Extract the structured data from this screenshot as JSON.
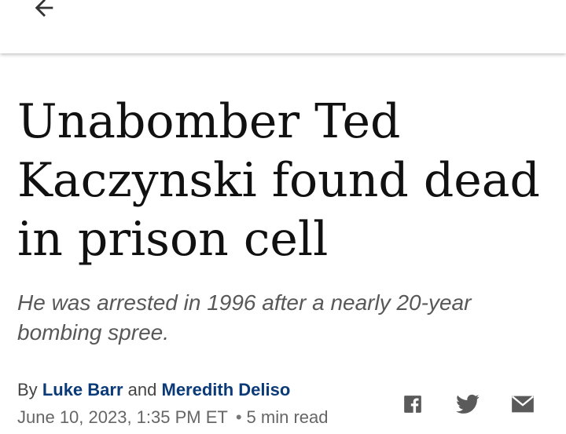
{
  "header": {
    "back_icon": "arrow-left-icon"
  },
  "article": {
    "headline": "Unabomber Ted Kaczynski found dead in prison cell",
    "subhead": "He was arrested in 1996 after a nearly 20-year bombing spree.",
    "byline": {
      "prefix": "By",
      "author1": "Luke Barr",
      "conjunction": "and",
      "author2": "Meredith Deliso",
      "author_color": "#0b3a78"
    },
    "date": "June 10, 2023, 1:35 PM ET",
    "separator": "•",
    "read_time": "5 min read"
  },
  "share": {
    "icons": [
      "facebook-icon",
      "twitter-icon",
      "email-icon"
    ],
    "icon_color": "#5a5a5a"
  }
}
